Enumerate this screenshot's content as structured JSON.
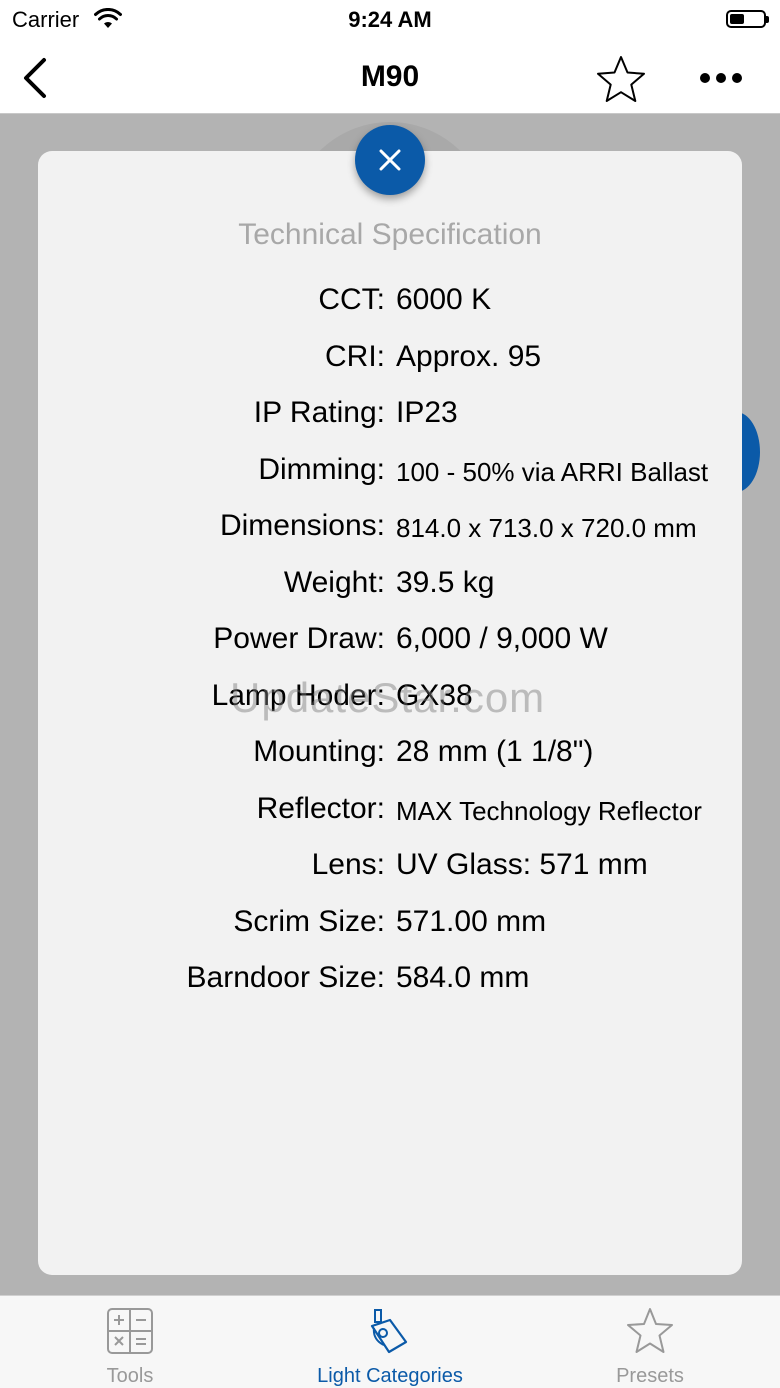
{
  "status": {
    "carrier": "Carrier",
    "time": "9:24 AM",
    "battery_level": 0.45
  },
  "nav": {
    "title": "M90",
    "back_icon": "chevron-left-icon",
    "favorite_icon": "star-icon",
    "more_icon": "ellipsis-icon"
  },
  "modal": {
    "title": "Technical Specification",
    "close_icon": "close-icon",
    "specs": [
      {
        "label": "CCT:",
        "value": "6000 K"
      },
      {
        "label": "CRI:",
        "value": "Approx. 95"
      },
      {
        "label": "IP Rating:",
        "value": "IP23"
      },
      {
        "label": "Dimming:",
        "value": "100 - 50% via ARRI Ballast"
      },
      {
        "label": "Dimensions:",
        "value": "814.0 x 713.0 x 720.0 mm"
      },
      {
        "label": "Weight:",
        "value": "39.5 kg"
      },
      {
        "label": "Power Draw:",
        "value": "6,000 / 9,000 W"
      },
      {
        "label": "Lamp Hoder:",
        "value": "GX38"
      },
      {
        "label": "Mounting:",
        "value": "28 mm (1 1/8\")"
      },
      {
        "label": "Reflector:",
        "value": "MAX Technology Reflector"
      },
      {
        "label": "Lens:",
        "value": "UV Glass: 571 mm"
      },
      {
        "label": "Scrim Size:",
        "value": "571.00 mm"
      },
      {
        "label": "Barndoor Size:",
        "value": "584.0 mm"
      }
    ]
  },
  "watermark": "UpdateStar.com",
  "tabs": [
    {
      "label": "Tools",
      "icon": "calculator-icon",
      "active": false
    },
    {
      "label": "Light Categories",
      "icon": "lamp-icon",
      "active": true
    },
    {
      "label": "Presets",
      "icon": "star-outline-icon",
      "active": false
    }
  ],
  "colors": {
    "accent": "#0b5aa8",
    "overlay": "#b3b3b3",
    "inactive_tab": "#999999"
  }
}
